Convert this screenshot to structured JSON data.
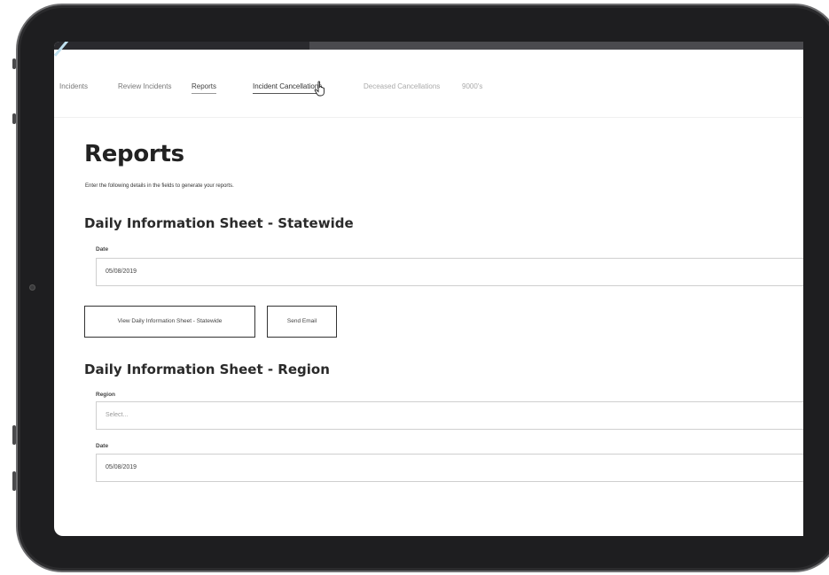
{
  "nav": {
    "tabs": [
      {
        "label": "Incidents"
      },
      {
        "label": "Review Incidents"
      },
      {
        "label": "Reports"
      },
      {
        "label": "Incident Cancellations"
      },
      {
        "label": "Deceased Cancellations"
      },
      {
        "label": "9000's"
      }
    ]
  },
  "page": {
    "title": "Reports",
    "intro": "Enter the following details in the fields to generate your reports."
  },
  "statewide": {
    "title": "Daily Information Sheet - Statewide",
    "date_label": "Date",
    "date_value": "05/08/2019",
    "view_button": "View Daily Information Sheet - Statewide",
    "email_button": "Send Email"
  },
  "region": {
    "title": "Daily Information Sheet - Region",
    "region_label": "Region",
    "region_placeholder": "Select...",
    "date_label": "Date",
    "date_value": "05/08/2019"
  },
  "colors": {
    "bezel": "#1e1e20",
    "text": "#222222",
    "border": "#cfcfcf"
  }
}
